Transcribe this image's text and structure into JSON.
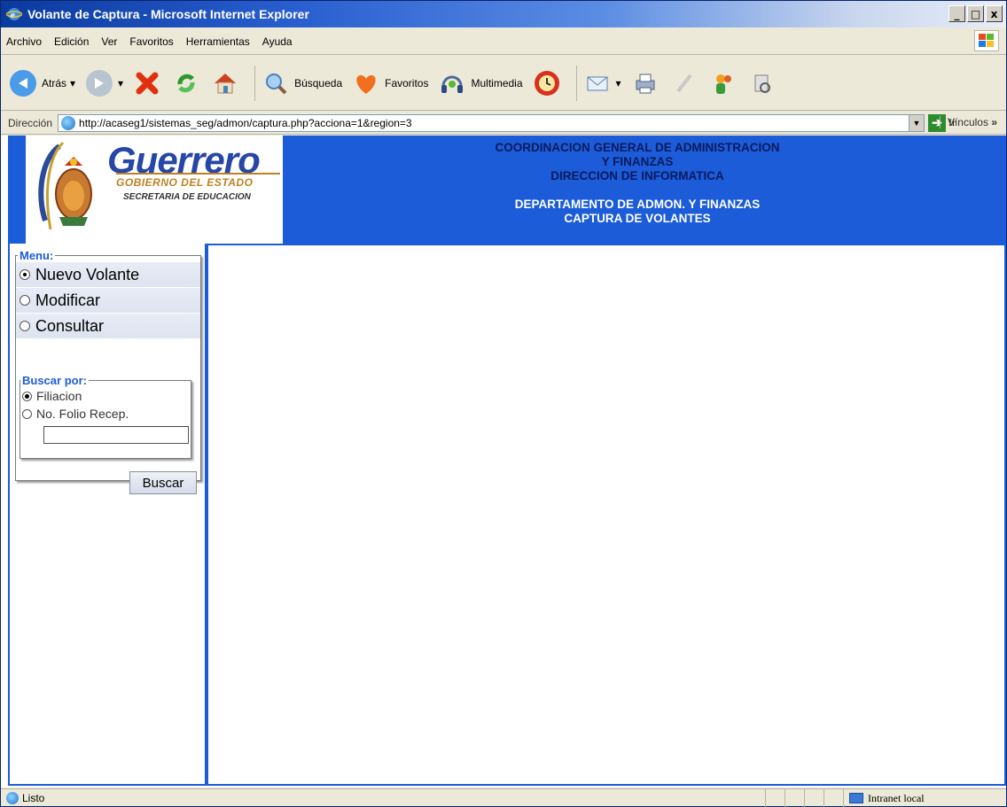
{
  "window": {
    "title": "Volante de Captura - Microsoft Internet Explorer",
    "buttons": {
      "minimize": "_",
      "maximize": "□",
      "close": "x"
    }
  },
  "menubar": {
    "items": [
      "Archivo",
      "Edición",
      "Ver",
      "Favoritos",
      "Herramientas",
      "Ayuda"
    ]
  },
  "toolbar": {
    "back_label": "Atrás",
    "search_label": "Búsqueda",
    "favorites_label": "Favoritos",
    "media_label": "Multimedia"
  },
  "address": {
    "label": "Dirección",
    "url": "http://acaseg1/sistemas_seg/admon/captura.php?acciona=1&region=3",
    "go_label": "Ir",
    "links_label": "Vínculos"
  },
  "header": {
    "logo_title": "Guerrero",
    "logo_subtitle": "GOBIERNO DEL ESTADO",
    "logo_secretaria": "SECRETARIA DE EDUCACION",
    "line1": "COORDINACION GENERAL DE ADMINISTRACION",
    "line2": "Y FINANZAS",
    "line3": "DIRECCION DE INFORMATICA",
    "line4": "DEPARTAMENTO DE ADMON. Y FINANZAS",
    "line5": "CAPTURA DE VOLANTES"
  },
  "menu": {
    "legend": "Menu:",
    "options": [
      {
        "label": "Nuevo Volante",
        "selected": true
      },
      {
        "label": "Modificar",
        "selected": false
      },
      {
        "label": "Consultar",
        "selected": false
      }
    ]
  },
  "buscar": {
    "legend": "Buscar por:",
    "options": [
      {
        "label": "Filiacion",
        "selected": true
      },
      {
        "label": "No. Folio Recep.",
        "selected": false
      }
    ],
    "input_value": "",
    "button_label": "Buscar"
  },
  "status": {
    "text": "Listo",
    "zone": "Intranet local"
  },
  "colors": {
    "accent": "#1c5cd8",
    "header_dark_text": "#0a1a5e"
  }
}
